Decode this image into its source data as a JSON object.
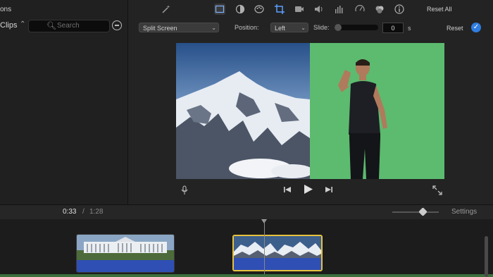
{
  "browser": {
    "partial_label": "ons",
    "clips_label": "Clips",
    "clips_chevron": "⌃",
    "search_placeholder": "Search"
  },
  "toolbar": {
    "icons": [
      "magic-wand-icon",
      "video-overlay-icon",
      "color-balance-icon",
      "color-palette-icon",
      "crop-icon",
      "stabilization-icon",
      "volume-icon",
      "equalizer-icon",
      "speed-icon",
      "filter-icon",
      "info-icon"
    ],
    "reset_all": "Reset All"
  },
  "overlay_controls": {
    "style_value": "Split Screen",
    "position_label": "Position:",
    "position_value": "Left",
    "slide_label": "Slide:",
    "slide_value": "0",
    "slide_unit": "s",
    "reset_label": "Reset",
    "apply_icon": "checkmark-icon"
  },
  "playback": {
    "current_time": "0:33",
    "separator": "/",
    "total_time": "1:28",
    "settings_label": "Settings"
  },
  "colors": {
    "accent_blue": "#2f7de1",
    "selection_yellow": "#e7c23d",
    "audio_blue": "#2f4fb5",
    "greenscreen": "#5cbb6f"
  }
}
